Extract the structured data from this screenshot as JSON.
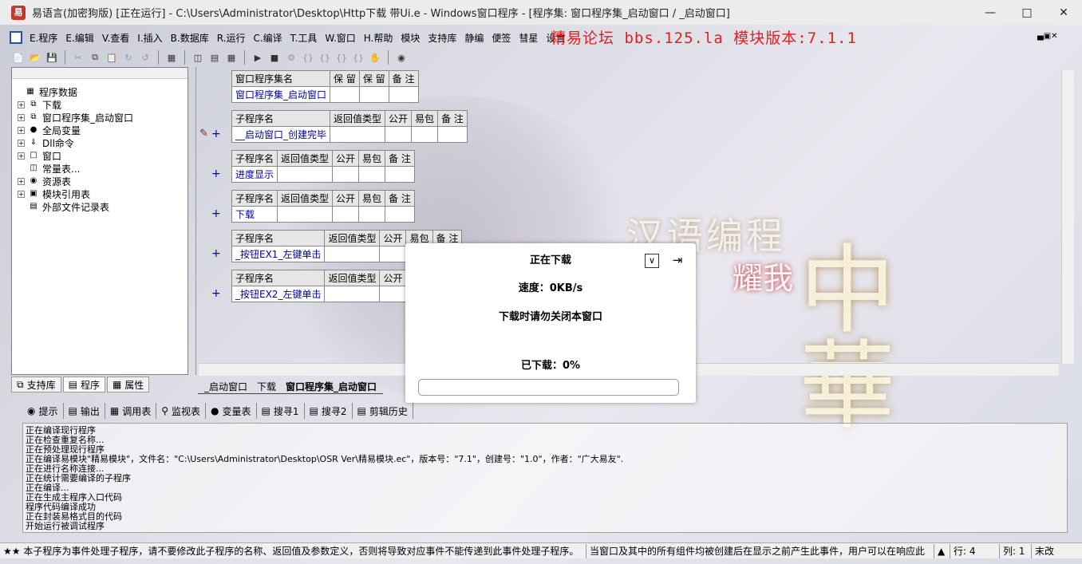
{
  "window": {
    "title": "易语言(加密狗版) [正在运行] - C:\\Users\\Administrator\\Desktop\\Http下载 带Ui.e - Windows窗口程序 - [程序集: 窗口程序集_启动窗口 / _启动窗口]",
    "app_icon_glyph": "易"
  },
  "menubar": {
    "items": [
      "E.程序",
      "E.编辑",
      "V.查看",
      "I.插入",
      "B.数据库",
      "R.运行",
      "C.编译",
      "T.工具",
      "W.窗口",
      "H.帮助",
      "模块",
      "支持库",
      "静编",
      "便签",
      "彗星",
      "设置"
    ],
    "forum": "精易论坛 bbs.125.la 模块版本:7.1.1"
  },
  "left_panel": {
    "tree": [
      {
        "label": "程序数据",
        "icon": "database-icon",
        "expand": false,
        "indent": 0
      },
      {
        "label": "下载",
        "icon": "module-icon",
        "expand": true,
        "indent": 1
      },
      {
        "label": "窗口程序集_启动窗口",
        "icon": "module-icon",
        "expand": true,
        "indent": 1
      },
      {
        "label": "全局变量",
        "icon": "variable-icon",
        "expand": true,
        "indent": 1
      },
      {
        "label": "Dll命令",
        "icon": "dll-icon",
        "expand": true,
        "indent": 1
      },
      {
        "label": "窗口",
        "icon": "window-icon",
        "expand": true,
        "indent": 1
      },
      {
        "label": "常量表...",
        "icon": "constant-icon",
        "expand": false,
        "indent": 1
      },
      {
        "label": "资源表",
        "icon": "resource-icon",
        "expand": true,
        "indent": 1
      },
      {
        "label": "模块引用表",
        "icon": "module-ref-icon",
        "expand": true,
        "indent": 1
      },
      {
        "label": "外部文件记录表",
        "icon": "file-icon",
        "expand": false,
        "indent": 1
      }
    ],
    "tabs": [
      "支持库",
      "程序",
      "属性"
    ]
  },
  "code": {
    "assembly_table": {
      "headers": [
        "窗口程序集名",
        "保 留",
        "保 留",
        "备 注"
      ],
      "name": "窗口程序集_启动窗口"
    },
    "subs": [
      {
        "headers": [
          "子程序名",
          "返回值类型",
          "公开",
          "易包",
          "备 注"
        ],
        "name": "__启动窗口_创建完毕"
      },
      {
        "headers": [
          "子程序名",
          "返回值类型",
          "公开",
          "易包",
          "备 注"
        ],
        "name": "进度显示"
      },
      {
        "headers": [
          "子程序名",
          "返回值类型",
          "公开",
          "易包",
          "备 注"
        ],
        "name": "下载"
      },
      {
        "headers": [
          "子程序名",
          "返回值类型",
          "公开",
          "易包",
          "备 注"
        ],
        "name": "_按钮EX1_左键单击"
      },
      {
        "headers": [
          "子程序名",
          "返回值类型",
          "公开"
        ],
        "name": "_按钮EX2_左键单击"
      }
    ],
    "plus": "+",
    "tabs": [
      "_启动窗口",
      "下载",
      "窗口程序集_启动窗口"
    ]
  },
  "output": {
    "tabs": [
      "提示",
      "输出",
      "调用表",
      "监视表",
      "变量表",
      "搜寻1",
      "搜寻2",
      "剪辑历史"
    ],
    "lines": [
      "正在编译现行程序",
      "正在检查重复名称...",
      "正在预处理现行程序",
      "正在编译易模块\"精易模块\"，文件名：\"C:\\Users\\Administrator\\Desktop\\OSR Ver\\精易模块.ec\"，版本号：\"7.1\"，创建号：\"1.0\"，作者：\"广大易友\".",
      "正在进行名称连接...",
      "正在统计需要编译的子程序",
      "正在编译...",
      "正在生成主程序入口代码",
      "程序代码编译成功",
      "正在封装易格式目的代码",
      "开始运行被调试程序"
    ]
  },
  "statusbar": {
    "hint": "★★ 本子程序为事件处理子程序，请不要修改此子程序的名称、返回值及参数定义，否则将导致对应事件不能传递到此事件处理子程序。",
    "event": "当窗口及其中的所有组件均被创建后在显示之前产生此事件，用户可以在响应此",
    "row": "行: 4",
    "col": "列: 1",
    "mode": "末改"
  },
  "dialog": {
    "title": "正在下载",
    "speed": "速度：0KB/s",
    "warning": "下载时请勿关闭本窗口",
    "downloaded": "已下载：0%",
    "progress": 0
  },
  "watermark": {
    "text": "汉语编程",
    "seal": "耀我",
    "big": "中華"
  }
}
